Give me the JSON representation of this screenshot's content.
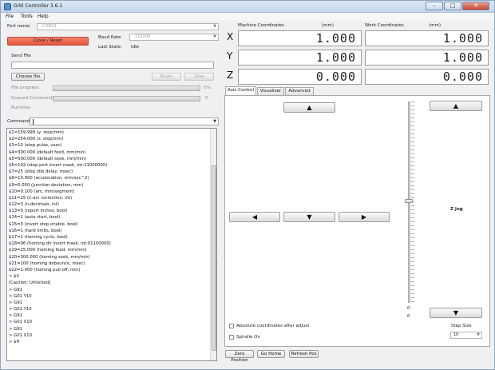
{
  "window": {
    "title": "Grbl Controller 3.6.1",
    "controls": {
      "minimize": "–",
      "maximize": "□",
      "close": "✕"
    }
  },
  "menu": [
    "File",
    "Tools",
    "Help"
  ],
  "connection": {
    "port_label": "Port name",
    "port_value": "COM21",
    "close_button": "Close / Reset",
    "baud_label": "Baud Rate",
    "baud_value": "115200",
    "last_state_label": "Last State:",
    "last_state_value": "Idle"
  },
  "send_file": {
    "label": "Send File",
    "path": "",
    "choose_button": "Choose file",
    "begin_button": "Begin",
    "stop_button": "Stop",
    "file_progress_label": "File progress",
    "file_progress_value": "0%",
    "queued_label": "Queued Commands",
    "queued_value": "0",
    "runtime_label": "Runtime:"
  },
  "command": {
    "label": "Command",
    "value": ""
  },
  "console_lines": [
    "$1=159.999 (y, step/mm)",
    "$2=254.000 (z, step/mm)",
    "$3=10 (step pulse, usec)",
    "$4=300.000 (default feed, mm/min)",
    "$5=500.000 (default seek, mm/min)",
    "$6=192 (step port invert mask, int:11000000)",
    "$7=25 (step idle delay, msec)",
    "$8=10.000 (acceleration, mm/sec^2)",
    "$9=0.050 (junction deviation, mm)",
    "$10=0.100 (arc, mm/segment)",
    "$11=25 (n-arc correction, int)",
    "$12=3 (n-decimals, int)",
    "$13=0 (report inches, bool)",
    "$14=1 (auto start, bool)",
    "$15=0 (invert step enable, bool)",
    "$16=1 (hard limits, bool)",
    "$17=1 (homing cycle, bool)",
    "$18=96 (homing dir invert mask, int:01100000)",
    "$19=25.000 (homing feed, mm/min)",
    "$20=300.000 (homing seek, mm/min)",
    "$21=100 (homing debounce, msec)",
    "$22=1.000 (homing pull-off, mm)",
    "> $X",
    "[Caution: Unlocked]",
    "> G91",
    "> G01 Y10",
    "> G91",
    "> G01 Y10",
    "> G91",
    "> G01 X10",
    "> G91",
    "> G01 X10",
    "> $H"
  ],
  "coordinates": {
    "machine_label": "Machine Coordinates",
    "work_label": "Work Coordinates",
    "unit": "(mm)",
    "axes": [
      "X",
      "Y",
      "Z"
    ],
    "machine": [
      "1.000",
      "1.000",
      "0.000"
    ],
    "work": [
      "1.000",
      "1.000",
      "0.000"
    ]
  },
  "tabs": [
    "Axis Control",
    "Visualizer",
    "Advanced"
  ],
  "jog": {
    "up": "▲",
    "down": "▼",
    "left": "◀",
    "right": "▶",
    "z_up": "▲",
    "z_down": "▼",
    "z_label": "Z Jog",
    "z_min": "0",
    "z_max": "0"
  },
  "options": {
    "absolute_coords": "Absolute coordinates after adjust",
    "spindle_on": "Spindle On",
    "step_size_label": "Step Size",
    "step_size_value": "10"
  },
  "bottom_buttons": {
    "zero": "Zero Position",
    "home": "Go Home",
    "refresh": "Refresh Pos"
  }
}
